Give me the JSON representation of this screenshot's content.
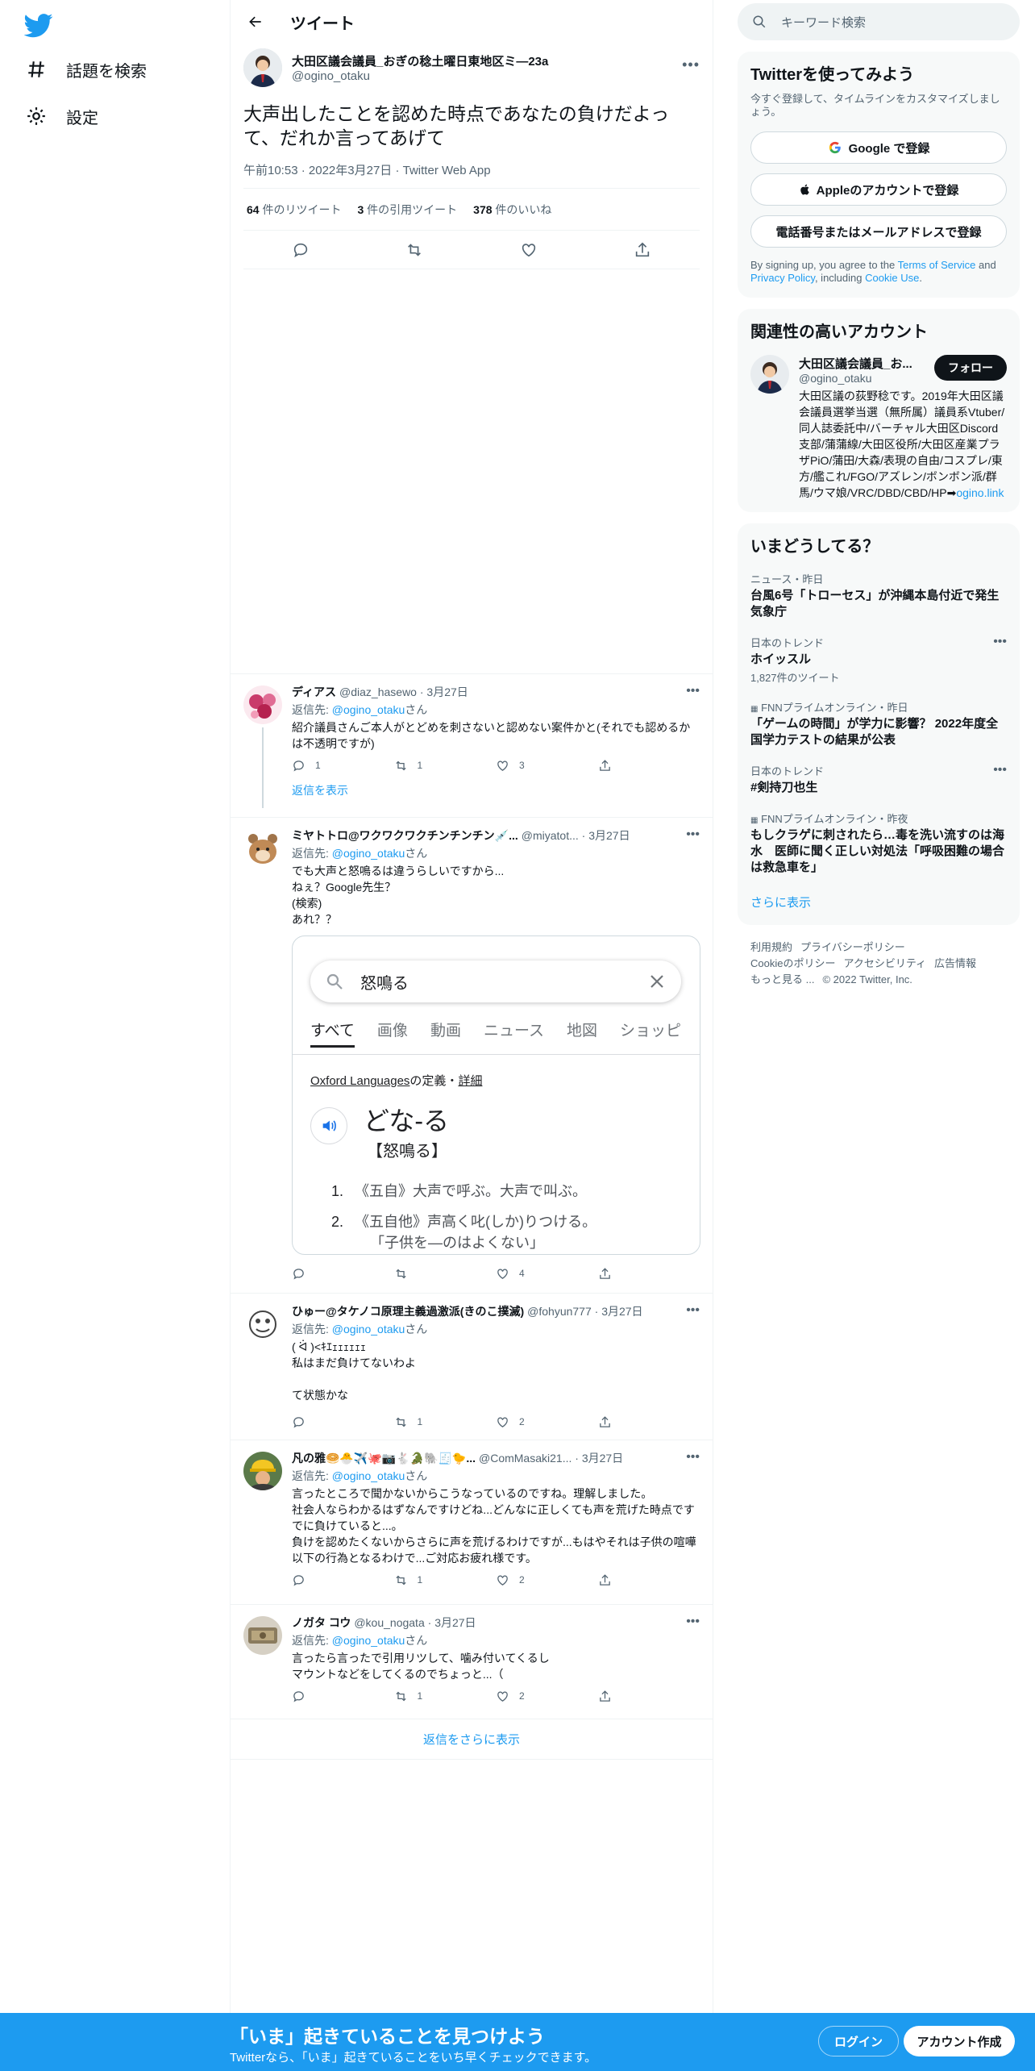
{
  "nav": {
    "explore_label": "話題を検索",
    "settings_label": "設定"
  },
  "header": {
    "title": "ツイート"
  },
  "tweet": {
    "display_name": "大田区議会議員_おぎの稔土曜日東地区ミ―23a",
    "handle": "@ogino_otaku",
    "text": "大声出したことを認めた時点であなたの負けだよって、だれか言ってあげて",
    "time": "午前10:53",
    "date": "2022年3月27日",
    "source": "Twitter Web App",
    "retweets_count": "64",
    "retweets_label": "件のリツイート",
    "quotes_count": "3",
    "quotes_label": "件の引用ツイート",
    "likes_count": "378",
    "likes_label": "件のいいね"
  },
  "replies": [
    {
      "name": "ディアス",
      "handle": "@diaz_hasewo",
      "date": "3月27日",
      "replying_prefix": "返信先: ",
      "replying_to": "@ogino_otaku",
      "replying_suffix": "さん",
      "text": "紹介議員さんご本人がとどめを刺さないと認めない案件かと(それでも認めるかは不透明ですが)",
      "replies": "1",
      "retweets": "1",
      "likes": "3",
      "show_thread": "返信を表示"
    },
    {
      "name": "ミヤトトロ@ワクワクワクチンチンチン💉...",
      "handle": "@miyatot...",
      "date": "3月27日",
      "replying_prefix": "返信先: ",
      "replying_to": "@ogino_otaku",
      "replying_suffix": "さん",
      "text": "でも大声と怒鳴るは違うらしいですから...\nねぇ？Google先生？\n(検索)\nあれ？？",
      "replies": "",
      "retweets": "",
      "likes": "4"
    },
    {
      "name": "ひゅー@タケノコ原理主義過激派(きのこ撲滅)",
      "handle": "@fohyun777",
      "date": "3月27日",
      "replying_prefix": "返信先: ",
      "replying_to": "@ogino_otaku",
      "replying_suffix": "さん",
      "text": "( ᐛ )<ｷｴｪｪｪｪｪｪ\n私はまだ負けてないわよ\n\nて状態かな",
      "replies": "",
      "retweets": "1",
      "likes": "2"
    },
    {
      "name": "凡の雅🥯🐣✈️🐙📷🐇🐊🐘🧾🐤...",
      "handle": "@ComMasaki21...",
      "date": "3月27日",
      "replying_prefix": "返信先: ",
      "replying_to": "@ogino_otaku",
      "replying_suffix": "さん",
      "text": "言ったところで聞かないからこうなっているのですね。理解しました。\n社会人ならわかるはずなんですけどね...どんなに正しくても声を荒げた時点ですでに負けていると...。\n負けを認めたくないからさらに声を荒げるわけですが...もはやそれは子供の喧嘩以下の行為となるわけで...ご対応お疲れ様です。",
      "replies": "",
      "retweets": "1",
      "likes": "2"
    },
    {
      "name": "ノガタ コウ",
      "handle": "@kou_nogata",
      "date": "3月27日",
      "replying_prefix": "返信先: ",
      "replying_to": "@ogino_otaku",
      "replying_suffix": "さん",
      "text": "言ったら言ったで引用リツして、噛み付いてくるし\nマウントなどをしてくるのでちょっと...（",
      "replies": "",
      "retweets": "1",
      "likes": "2"
    }
  ],
  "google_image": {
    "query": "怒鳴る",
    "tabs": [
      "すべて",
      "画像",
      "動画",
      "ニュース",
      "地図",
      "ショッピ"
    ],
    "source_prefix": "Oxford Languages",
    "source_suffix": "の定義・",
    "source_detail": "詳細",
    "word": "どな-る",
    "kanji": "【怒鳴る】",
    "def1_num": "1.",
    "def1": "《五自》大声で呼ぶ。大声で叫ぶ。",
    "def2_num": "2.",
    "def2": "《五自他》声高く叱(しか)りつける。",
    "def2_example": "「子供を―のはよくない」"
  },
  "more_replies": "返信をさらに表示",
  "sidebar": {
    "search_placeholder": "キーワード検索",
    "signup_title": "Twitterを使ってみよう",
    "signup_sub": "今すぐ登録して、タイムラインをカスタマイズしましょう。",
    "google_btn": "Google で登録",
    "apple_btn": "Appleのアカウントで登録",
    "phone_btn": "電話番号またはメールアドレスで登録",
    "terms_1": "By signing up, you agree to the ",
    "terms_tos": "Terms of Service",
    "terms_2": " and ",
    "terms_privacy": "Privacy Policy",
    "terms_3": ", including ",
    "terms_cookie": "Cookie Use",
    "terms_4": ".",
    "relevant_title": "関連性の高いアカウント",
    "account_name": "大田区議会議員_お...",
    "account_handle": "@ogino_otaku",
    "account_bio": "大田区議の荻野稔です。2019年大田区議会議員選挙当選（無所属）議員系Vtuber/同人誌委託中/バーチャル大田区Discord支部/蒲蒲線/大田区役所/大田区産業プラザPiO/蒲田/大森/表現の自由/コスプレ/東方/艦これ/FGO/アズレン/ボンボン派/群馬/ウマ娘/VRC/DBD/CBD/HP➡",
    "account_link": "ogino.link",
    "follow_btn": "フォロー",
    "trends_title": "いまどうしてる？",
    "trends": [
      {
        "category": "ニュース・昨日",
        "title": "台風6号「トローセス」が沖縄本島付近で発生 気象庁",
        "count": ""
      },
      {
        "category": "日本のトレンド",
        "title": "ホイッスル",
        "count": "1,827件のツイート"
      },
      {
        "category": "FNNプライムオンライン・昨日",
        "title": "「ゲームの時間」が学力に影響？ 2022年度全国学力テストの結果が公表",
        "count": ""
      },
      {
        "category": "日本のトレンド",
        "title": "#剣持刀也生",
        "count": ""
      },
      {
        "category": "FNNプライムオンライン・昨夜",
        "title": "もしクラゲに刺されたら…毒を洗い流すのは海水　医師に聞く正しい対処法「呼吸困難の場合は救急車を」",
        "count": ""
      }
    ],
    "show_more": "さらに表示",
    "footer": [
      "利用規約",
      "プライバシーポリシー",
      "Cookieのポリシー",
      "アクセシビリティ",
      "広告情報",
      "もっと見る ...",
      "© 2022 Twitter, Inc."
    ]
  },
  "bottom": {
    "title": "「いま」起きていることを見つけよう",
    "subtitle": "Twitterなら、「いま」起きていることをいち早くチェックできます。",
    "login": "ログイン",
    "signup": "アカウント作成"
  },
  "colors": {
    "accent": "#1d9bf0",
    "text": "#0f1419",
    "secondary": "#536471"
  }
}
